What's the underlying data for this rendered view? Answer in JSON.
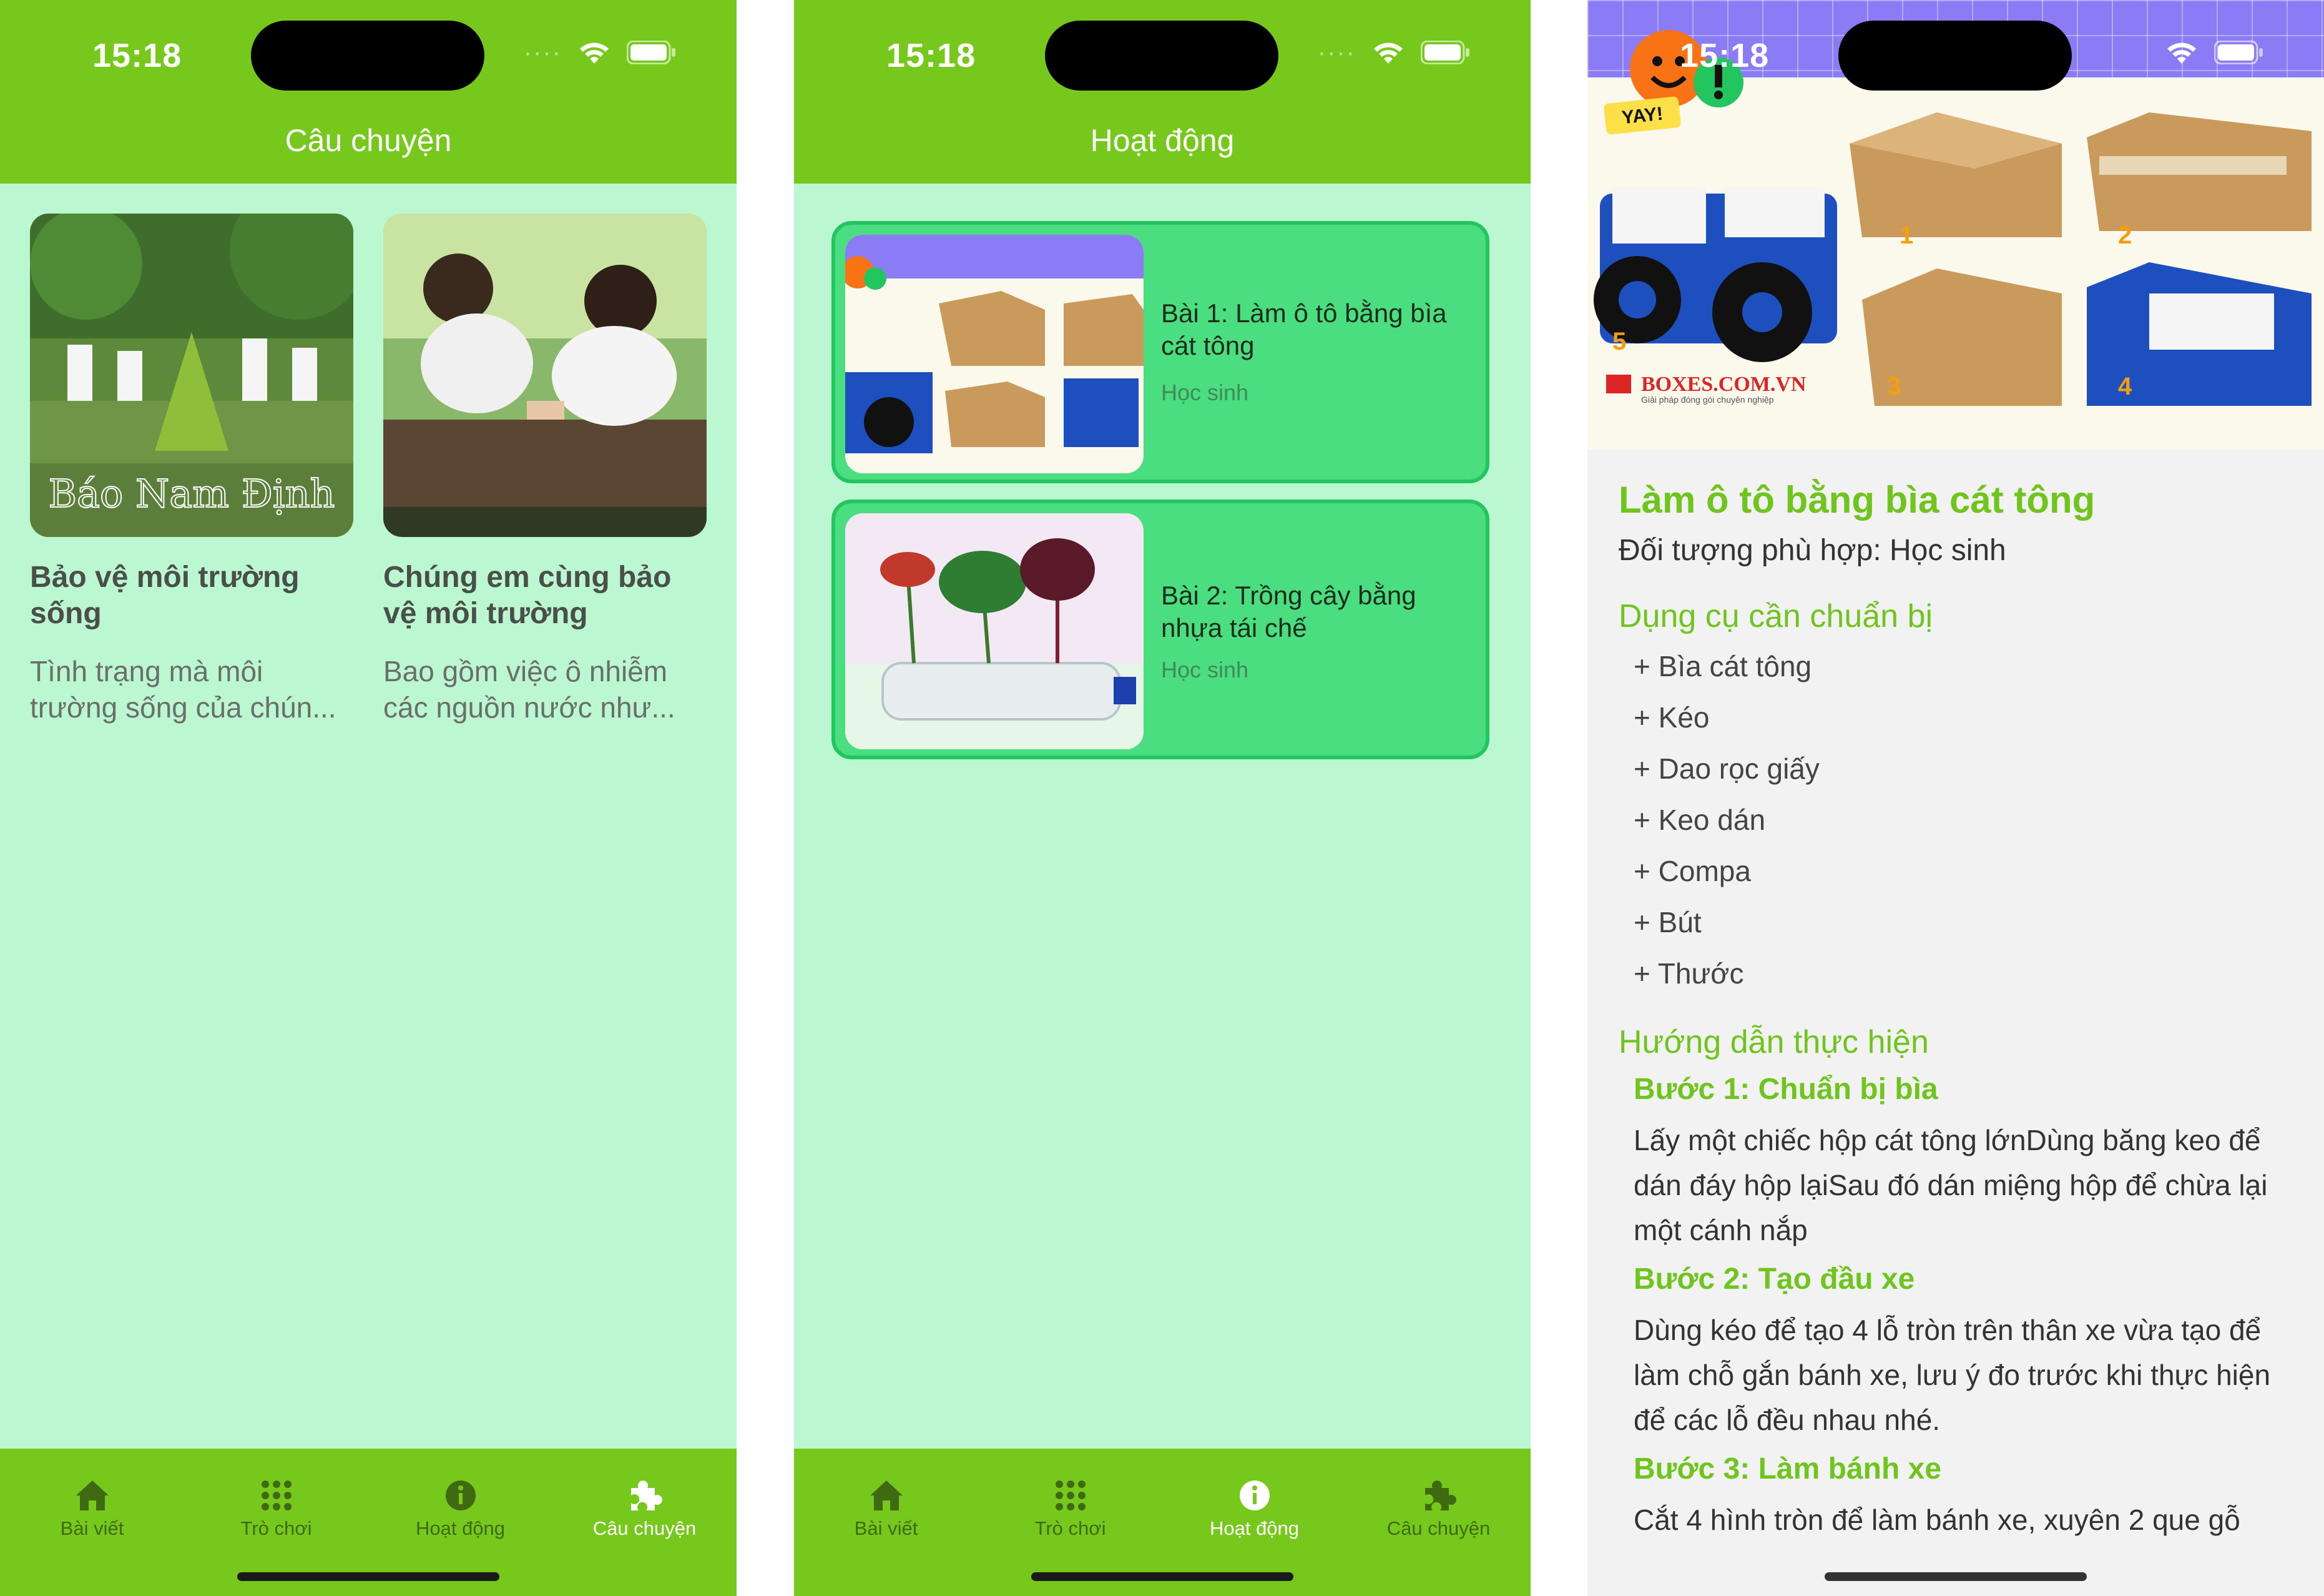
{
  "status": {
    "time": "15:18"
  },
  "screen1": {
    "title": "Câu chuyện",
    "stories": [
      {
        "title": "Bảo vệ môi trường sống",
        "desc": "Tình trạng mà môi trường sống của chún...",
        "watermark": "Báo Nam Định"
      },
      {
        "title": "Chúng em cùng bảo vệ môi trường",
        "desc": "Bao gồm việc ô nhiễm các nguồn nước như..."
      }
    ]
  },
  "screen2": {
    "title": "Hoạt động",
    "activities": [
      {
        "title": "Bài 1: Làm ô tô bằng bìa cát tông",
        "audience": "Học sinh"
      },
      {
        "title": "Bài 2: Trồng cây bằng nhựa tái chế",
        "audience": "Học sinh"
      }
    ]
  },
  "tabs": [
    {
      "label": "Bài viết",
      "icon": "home-icon"
    },
    {
      "label": "Trò chơi",
      "icon": "grid-icon"
    },
    {
      "label": "Hoạt động",
      "icon": "info-icon"
    },
    {
      "label": "Câu chuyện",
      "icon": "puzzle-icon"
    }
  ],
  "screen3": {
    "hero": {
      "brand": "BOXES.COM.VN",
      "tagline": "Giải pháp đóng gói chuyên nghiệp",
      "sticker": "YAY!",
      "steps": [
        "1",
        "2",
        "3",
        "4",
        "5"
      ]
    },
    "title": "Làm ô tô bằng bìa cát tông",
    "audience": "Đối tượng phù hợp: Học sinh",
    "tools_heading": "Dụng cụ cần chuẩn bị",
    "tools": [
      "+ Bìa cát tông",
      "+ Kéo",
      "+ Dao rọc giấy",
      "+ Keo dán",
      "+ Compa",
      "+ Bút",
      "+ Thước"
    ],
    "guide_heading": "Hướng dẫn thực hiện",
    "steps": [
      {
        "title": "Bước 1: Chuẩn bị bìa",
        "text": "Lấy một chiếc hộp cát tông lớnDùng băng keo để dán đáy hộp lạiSau đó dán miệng hộp để chừa lại một cánh nắp"
      },
      {
        "title": "Bước 2: Tạo đầu xe",
        "text": "Dùng kéo để tạo 4 lỗ tròn trên thân xe vừa tạo để làm chỗ gắn bánh xe, lưu ý đo trước khi thực hiện để các lỗ đều nhau nhé."
      },
      {
        "title": "Bước 3: Làm bánh xe",
        "text": "Cắt 4 hình tròn để làm bánh xe, xuyên 2 que gỗ"
      }
    ]
  },
  "colors": {
    "header": "#77c81c",
    "background": "#bbf7d0",
    "accent": "#6fc41e",
    "card": "#4ade80"
  }
}
